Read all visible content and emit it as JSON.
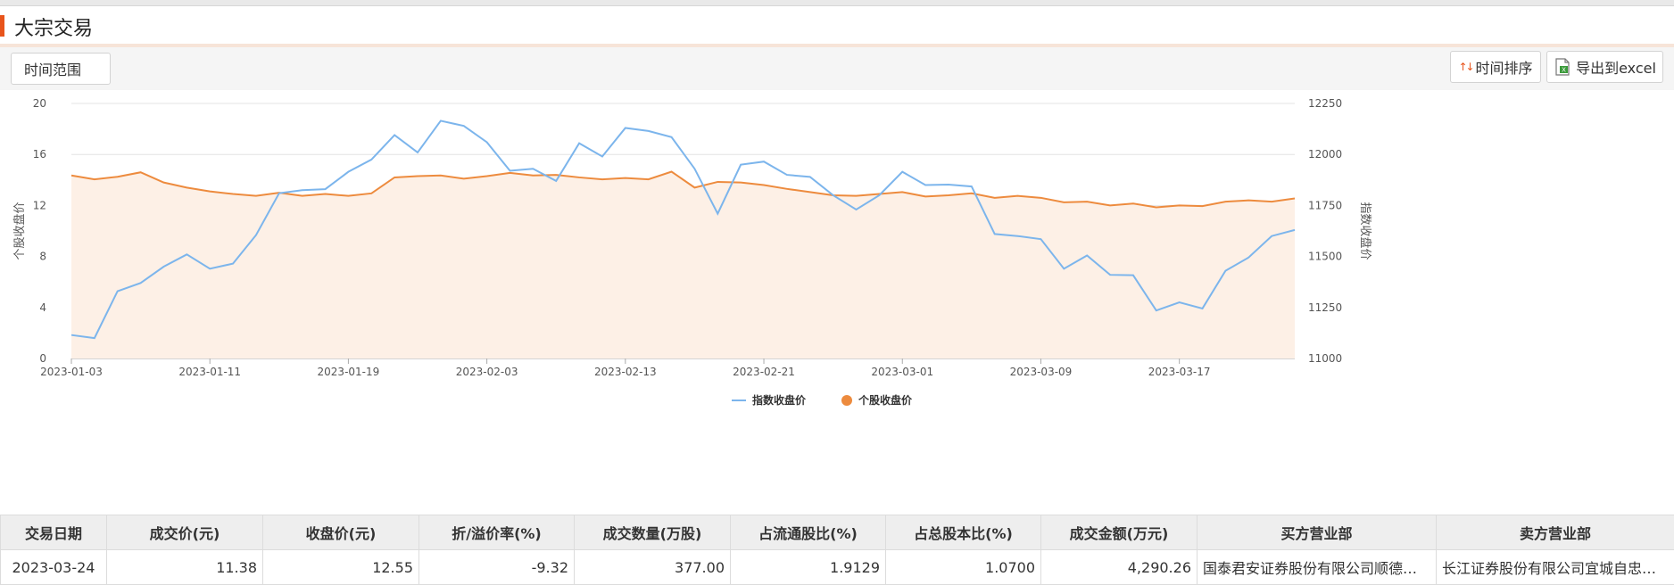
{
  "header": {
    "title": "大宗交易"
  },
  "toolbar": {
    "time_range_label": "时间范围",
    "sort_label": "时间排序",
    "export_label": "导出到excel"
  },
  "colors": {
    "accent": "#e8541b",
    "index_line": "#7cb5ec",
    "stock_line": "#ed8b3e",
    "stock_area": "#fdf0e6"
  },
  "chart_data": {
    "type": "line",
    "x": [
      "2023-01-03",
      "2023-01-04",
      "2023-01-05",
      "2023-01-06",
      "2023-01-09",
      "2023-01-10",
      "2023-01-11",
      "2023-01-12",
      "2023-01-13",
      "2023-01-16",
      "2023-01-17",
      "2023-01-18",
      "2023-01-19",
      "2023-01-20",
      "2023-01-30",
      "2023-01-31",
      "2023-02-01",
      "2023-02-02",
      "2023-02-03",
      "2023-02-06",
      "2023-02-07",
      "2023-02-08",
      "2023-02-09",
      "2023-02-10",
      "2023-02-13",
      "2023-02-14",
      "2023-02-15",
      "2023-02-16",
      "2023-02-17",
      "2023-02-20",
      "2023-02-21",
      "2023-02-22",
      "2023-02-23",
      "2023-02-24",
      "2023-02-27",
      "2023-02-28",
      "2023-03-01",
      "2023-03-02",
      "2023-03-03",
      "2023-03-06",
      "2023-03-07",
      "2023-03-08",
      "2023-03-09",
      "2023-03-10",
      "2023-03-13",
      "2023-03-14",
      "2023-03-15",
      "2023-03-16",
      "2023-03-17",
      "2023-03-20",
      "2023-03-21",
      "2023-03-22",
      "2023-03-23",
      "2023-03-24"
    ],
    "x_ticks": [
      "2023-01-03",
      "2023-01-11",
      "2023-01-19",
      "2023-02-03",
      "2023-02-13",
      "2023-02-21",
      "2023-03-01",
      "2023-03-09",
      "2023-03-17"
    ],
    "series": [
      {
        "name": "指数收盘价",
        "axis": "right",
        "values": [
          11115,
          11100,
          11330,
          11370,
          11450,
          11510,
          11440,
          11465,
          11605,
          11810,
          11825,
          11830,
          11915,
          11975,
          12095,
          12010,
          12165,
          12140,
          12060,
          11920,
          11930,
          11870,
          12055,
          11990,
          12130,
          12115,
          12085,
          11930,
          11710,
          11950,
          11965,
          11900,
          11890,
          11800,
          11730,
          11800,
          11915,
          11850,
          11852,
          11843,
          11610,
          11600,
          11585,
          11440,
          11505,
          11410,
          11408,
          11235,
          11275,
          11245,
          11430,
          11495,
          11600,
          11630
        ]
      },
      {
        "name": "个股收盘价",
        "axis": "left",
        "values": [
          14.35,
          14.05,
          14.25,
          14.6,
          13.8,
          13.4,
          13.1,
          12.9,
          12.75,
          13.0,
          12.75,
          12.9,
          12.75,
          12.95,
          14.2,
          14.3,
          14.35,
          14.1,
          14.3,
          14.55,
          14.35,
          14.4,
          14.2,
          14.05,
          14.15,
          14.05,
          14.65,
          13.4,
          13.85,
          13.8,
          13.6,
          13.3,
          13.05,
          12.8,
          12.75,
          12.9,
          13.05,
          12.7,
          12.8,
          12.95,
          12.6,
          12.75,
          12.6,
          12.25,
          12.3,
          12.0,
          12.15,
          11.85,
          12.0,
          11.95,
          12.3,
          12.4,
          12.3,
          12.55
        ]
      }
    ],
    "y_left": {
      "label": "个股收盘价",
      "lim": [
        0,
        20
      ],
      "ticks": [
        0,
        4,
        8,
        12,
        16,
        20
      ]
    },
    "y_right": {
      "label": "指数收盘价",
      "lim": [
        11000,
        12250
      ],
      "ticks": [
        11000,
        11250,
        11500,
        11750,
        12000,
        12250
      ]
    },
    "legend": [
      "指数收盘价",
      "个股收盘价"
    ],
    "legend_position": "bottom-center",
    "grid": true
  },
  "table": {
    "headers": [
      "交易日期",
      "成交价(元)",
      "收盘价(元)",
      "折/溢价率(%)",
      "成交数量(万股)",
      "占流通股比(%)",
      "占总股本比(%)",
      "成交金额(万元)",
      "买方营业部",
      "卖方营业部"
    ],
    "rows": [
      [
        "2023-03-24",
        "11.38",
        "12.55",
        "-9.32",
        "377.00",
        "1.9129",
        "1.0700",
        "4,290.26",
        "国泰君安证券股份有限公司顺德…",
        "长江证券股份有限公司宜城自忠…"
      ]
    ]
  }
}
